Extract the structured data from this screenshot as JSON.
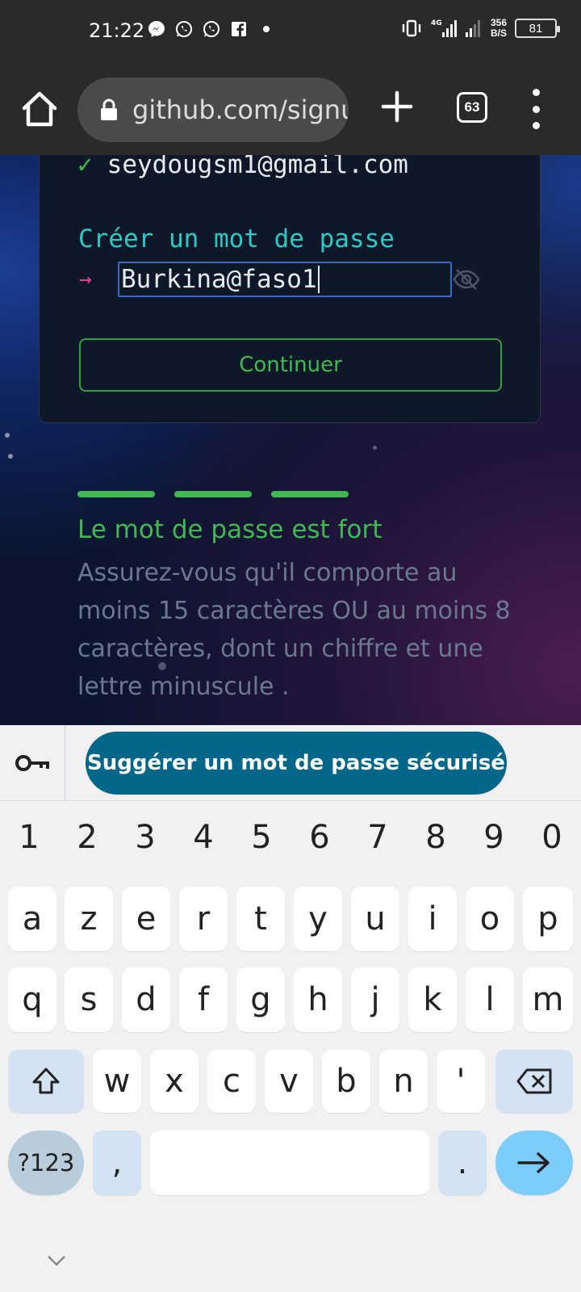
{
  "status_bar": {
    "time": "21:22",
    "notifications": [
      "messenger-icon",
      "whatsapp-icon",
      "whatsapp-business-icon",
      "facebook-icon",
      "dot-icon"
    ],
    "network": "4G",
    "speed_value": "356",
    "speed_unit": "B/S",
    "battery": "81"
  },
  "browser": {
    "url": "github.com/signu",
    "tab_count": "63",
    "home_icon": "home-icon",
    "lock_icon": "lock-icon",
    "new_tab_icon": "plus-icon",
    "menu_icon": "more-vert-icon"
  },
  "form": {
    "email_check": "✓",
    "email": "seydougsm1@gmail.com",
    "password_label": "Créer un mot de passe",
    "password_arrow": "→",
    "password_value": "Burkina@faso1",
    "continue_label": "Continuer"
  },
  "strength": {
    "level_bars": 3,
    "title": "Le mot de passe est fort",
    "help": "Assurez-vous qu'il comporte au moins 15 caractères OU au moins 8 caractères, dont un chiffre et une lettre minuscule ."
  },
  "suggestion": {
    "label": "Suggérer un mot de passe sécurisé",
    "icon": "key-icon"
  },
  "keyboard": {
    "numbers": [
      "1",
      "2",
      "3",
      "4",
      "5",
      "6",
      "7",
      "8",
      "9",
      "0"
    ],
    "row1": [
      "a",
      "z",
      "e",
      "r",
      "t",
      "y",
      "u",
      "i",
      "o",
      "p"
    ],
    "row2": [
      "q",
      "s",
      "d",
      "f",
      "g",
      "h",
      "j",
      "k",
      "l",
      "m"
    ],
    "row3": [
      "w",
      "x",
      "c",
      "v",
      "b",
      "n",
      "'"
    ],
    "symbols_label": "?123",
    "comma": ",",
    "period": "."
  },
  "colors": {
    "accent_green": "#3fb950",
    "label_teal": "#2bcac4",
    "arrow_pink": "#e0409a",
    "suggest_blue": "#00678a",
    "enter_blue": "#7ccdf9"
  }
}
